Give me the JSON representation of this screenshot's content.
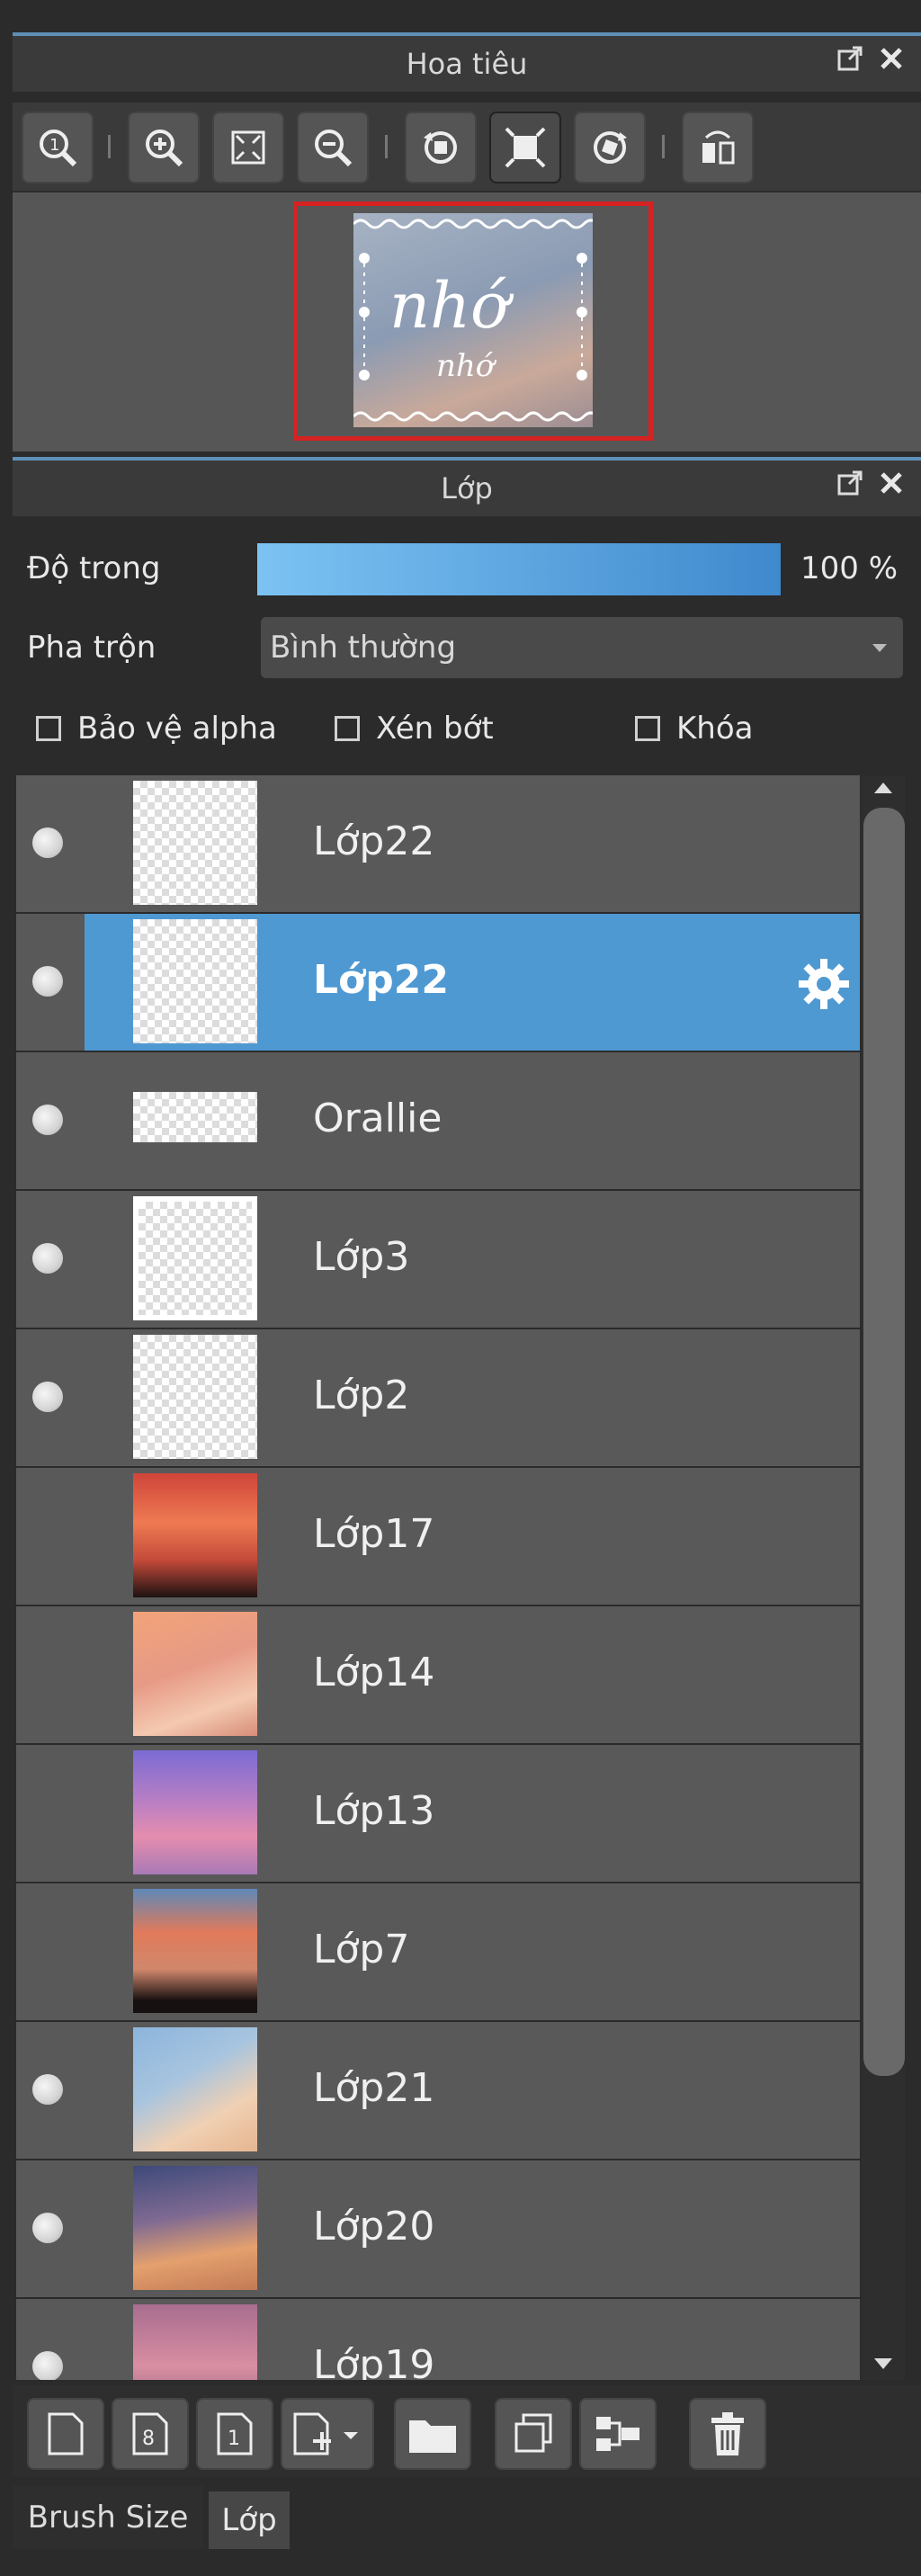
{
  "navigator": {
    "title": "Hoa tiêu",
    "tools": [
      "zoom-actual-icon",
      "zoom-in-icon",
      "fit-screen-icon",
      "zoom-out-icon",
      "rotate-left-icon",
      "fit-window-icon",
      "rotate-right-icon",
      "flip-icon"
    ],
    "preview_text_main": "nhớ",
    "preview_text_sub": "nhớ"
  },
  "layers_panel": {
    "title": "Lớp",
    "opacity_label": "Độ trong",
    "opacity_value": "100 %",
    "opacity_level": 1.0,
    "blend_label": "Pha trộn",
    "blend_value": "Bình thường",
    "checkboxes": {
      "protect_alpha": "Bảo vệ alpha",
      "clipping": "Xén bớt",
      "lock": "Khóa"
    },
    "layers": [
      {
        "name": "Lớp22",
        "visible": true,
        "thumb": "transparent-text"
      },
      {
        "name": "Lớp22",
        "visible": true,
        "thumb": "transparent",
        "selected": true
      },
      {
        "name": "Orallie",
        "visible": true,
        "thumb": "transparent-strip"
      },
      {
        "name": "Lớp3",
        "visible": true,
        "thumb": "transparent-frame"
      },
      {
        "name": "Lớp2",
        "visible": true,
        "thumb": "transparent"
      },
      {
        "name": "Lớp17",
        "visible": false,
        "thumb": "sky-red"
      },
      {
        "name": "Lớp14",
        "visible": false,
        "thumb": "sky-peach"
      },
      {
        "name": "Lớp13",
        "visible": false,
        "thumb": "sky-purple"
      },
      {
        "name": "Lớp7",
        "visible": false,
        "thumb": "sky-house"
      },
      {
        "name": "Lớp21",
        "visible": true,
        "thumb": "sky-blue"
      },
      {
        "name": "Lớp20",
        "visible": true,
        "thumb": "sky-moon"
      },
      {
        "name": "Lớp19",
        "visible": true,
        "thumb": "sky-pink"
      }
    ]
  },
  "bottom_tools": [
    "new-layer-icon",
    "new-8bit-layer-icon",
    "new-1bit-layer-icon",
    "add-layer-menu-icon",
    "new-folder-icon",
    "duplicate-layer-icon",
    "merge-down-icon",
    "delete-layer-icon"
  ],
  "tabs": [
    "Brush Size",
    "Lớp"
  ]
}
